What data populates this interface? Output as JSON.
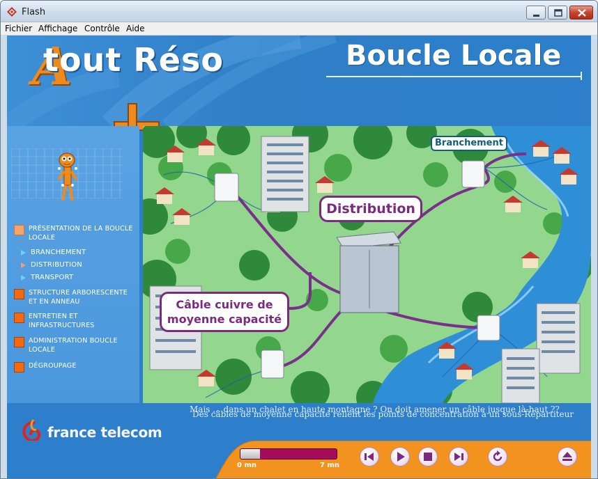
{
  "window": {
    "title": "Flash"
  },
  "menubar": {
    "items": [
      "Fichier",
      "Affichage",
      "Contrôle",
      "Aide"
    ]
  },
  "header": {
    "logo_initial": "A",
    "logo_rest": "tout Réso",
    "section_title": "Boucle Locale"
  },
  "sidebar": {
    "items": [
      {
        "label": "PRÉSENTATION DE LA BOUCLE LOCALE",
        "active": true
      },
      {
        "label": "STRUCTURE ARBORESCENTE ET EN ANNEAU"
      },
      {
        "label": "ENTRETIEN ET INFRASTRUCTURES"
      },
      {
        "label": "ADMINISTRATION BOUCLE LOCALE"
      },
      {
        "label": "DÉGROUPAGE"
      }
    ],
    "subitems": [
      {
        "label": "BRANCHEMENT"
      },
      {
        "label": "DISTRIBUTION",
        "active": true
      },
      {
        "label": "TRANSPORT"
      }
    ]
  },
  "map": {
    "callouts": {
      "branchement": "Branchement",
      "distribution": "Distribution",
      "cable_line1": "Câble cuivre de",
      "cable_line2": "moyenne capacité"
    }
  },
  "caption": {
    "line_a": "Mais ... dans un chalet en haute montagne ? On doit amener un câble jusque là-haut ??",
    "line_b": "Des câbles de moyenne capacité relient les points de concentration à un sous-Répartiteur"
  },
  "brand": {
    "name": "france telecom"
  },
  "player": {
    "progress": 0.2,
    "start_label": "0 mn",
    "end_label": "7 mn"
  },
  "colors": {
    "accent_orange": "#f26a10",
    "callout_purple": "#7b2b7d",
    "stage_blue": "#2e7fcb"
  }
}
